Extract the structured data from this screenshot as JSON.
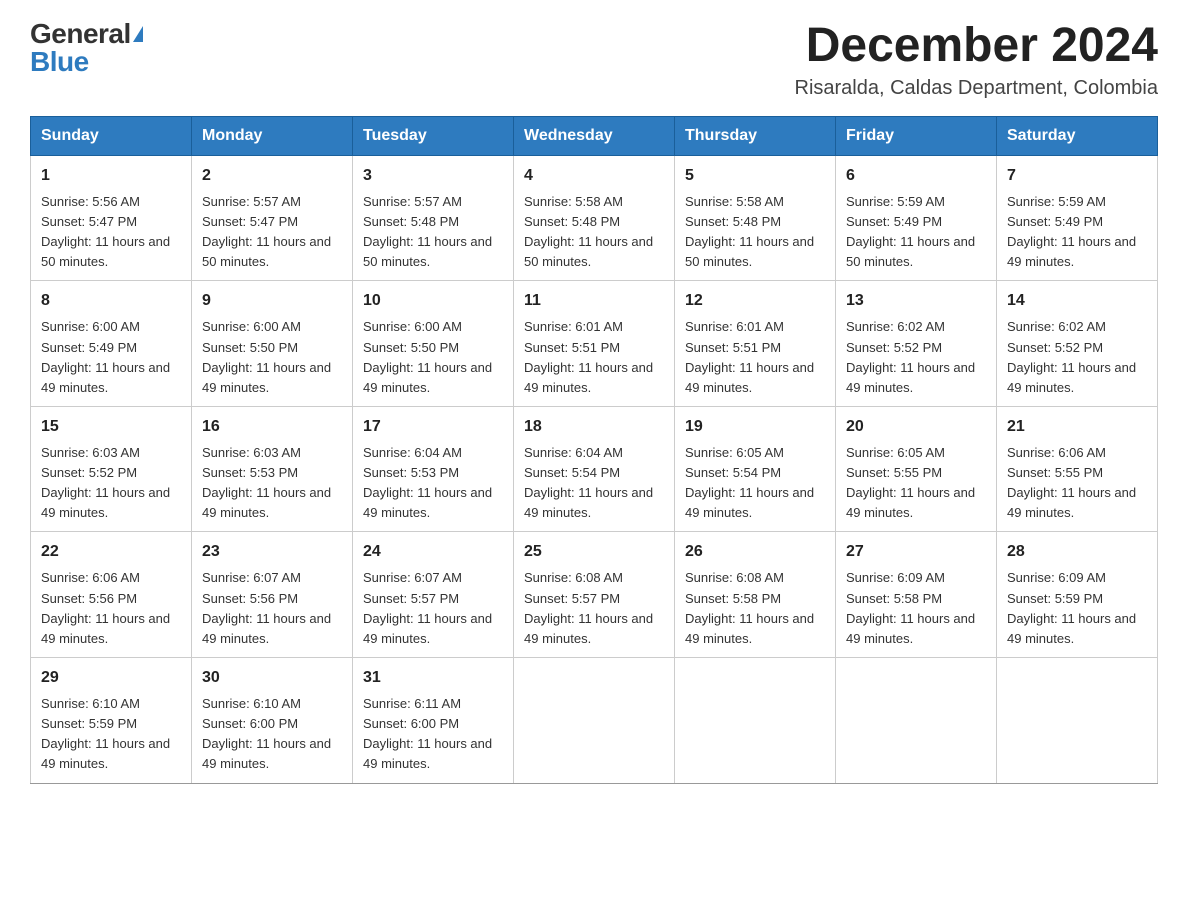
{
  "logo": {
    "general": "General",
    "blue": "Blue"
  },
  "title": {
    "month_year": "December 2024",
    "location": "Risaralda, Caldas Department, Colombia"
  },
  "headers": [
    "Sunday",
    "Monday",
    "Tuesday",
    "Wednesday",
    "Thursday",
    "Friday",
    "Saturday"
  ],
  "weeks": [
    [
      {
        "day": "1",
        "sunrise": "Sunrise: 5:56 AM",
        "sunset": "Sunset: 5:47 PM",
        "daylight": "Daylight: 11 hours and 50 minutes."
      },
      {
        "day": "2",
        "sunrise": "Sunrise: 5:57 AM",
        "sunset": "Sunset: 5:47 PM",
        "daylight": "Daylight: 11 hours and 50 minutes."
      },
      {
        "day": "3",
        "sunrise": "Sunrise: 5:57 AM",
        "sunset": "Sunset: 5:48 PM",
        "daylight": "Daylight: 11 hours and 50 minutes."
      },
      {
        "day": "4",
        "sunrise": "Sunrise: 5:58 AM",
        "sunset": "Sunset: 5:48 PM",
        "daylight": "Daylight: 11 hours and 50 minutes."
      },
      {
        "day": "5",
        "sunrise": "Sunrise: 5:58 AM",
        "sunset": "Sunset: 5:48 PM",
        "daylight": "Daylight: 11 hours and 50 minutes."
      },
      {
        "day": "6",
        "sunrise": "Sunrise: 5:59 AM",
        "sunset": "Sunset: 5:49 PM",
        "daylight": "Daylight: 11 hours and 50 minutes."
      },
      {
        "day": "7",
        "sunrise": "Sunrise: 5:59 AM",
        "sunset": "Sunset: 5:49 PM",
        "daylight": "Daylight: 11 hours and 49 minutes."
      }
    ],
    [
      {
        "day": "8",
        "sunrise": "Sunrise: 6:00 AM",
        "sunset": "Sunset: 5:49 PM",
        "daylight": "Daylight: 11 hours and 49 minutes."
      },
      {
        "day": "9",
        "sunrise": "Sunrise: 6:00 AM",
        "sunset": "Sunset: 5:50 PM",
        "daylight": "Daylight: 11 hours and 49 minutes."
      },
      {
        "day": "10",
        "sunrise": "Sunrise: 6:00 AM",
        "sunset": "Sunset: 5:50 PM",
        "daylight": "Daylight: 11 hours and 49 minutes."
      },
      {
        "day": "11",
        "sunrise": "Sunrise: 6:01 AM",
        "sunset": "Sunset: 5:51 PM",
        "daylight": "Daylight: 11 hours and 49 minutes."
      },
      {
        "day": "12",
        "sunrise": "Sunrise: 6:01 AM",
        "sunset": "Sunset: 5:51 PM",
        "daylight": "Daylight: 11 hours and 49 minutes."
      },
      {
        "day": "13",
        "sunrise": "Sunrise: 6:02 AM",
        "sunset": "Sunset: 5:52 PM",
        "daylight": "Daylight: 11 hours and 49 minutes."
      },
      {
        "day": "14",
        "sunrise": "Sunrise: 6:02 AM",
        "sunset": "Sunset: 5:52 PM",
        "daylight": "Daylight: 11 hours and 49 minutes."
      }
    ],
    [
      {
        "day": "15",
        "sunrise": "Sunrise: 6:03 AM",
        "sunset": "Sunset: 5:52 PM",
        "daylight": "Daylight: 11 hours and 49 minutes."
      },
      {
        "day": "16",
        "sunrise": "Sunrise: 6:03 AM",
        "sunset": "Sunset: 5:53 PM",
        "daylight": "Daylight: 11 hours and 49 minutes."
      },
      {
        "day": "17",
        "sunrise": "Sunrise: 6:04 AM",
        "sunset": "Sunset: 5:53 PM",
        "daylight": "Daylight: 11 hours and 49 minutes."
      },
      {
        "day": "18",
        "sunrise": "Sunrise: 6:04 AM",
        "sunset": "Sunset: 5:54 PM",
        "daylight": "Daylight: 11 hours and 49 minutes."
      },
      {
        "day": "19",
        "sunrise": "Sunrise: 6:05 AM",
        "sunset": "Sunset: 5:54 PM",
        "daylight": "Daylight: 11 hours and 49 minutes."
      },
      {
        "day": "20",
        "sunrise": "Sunrise: 6:05 AM",
        "sunset": "Sunset: 5:55 PM",
        "daylight": "Daylight: 11 hours and 49 minutes."
      },
      {
        "day": "21",
        "sunrise": "Sunrise: 6:06 AM",
        "sunset": "Sunset: 5:55 PM",
        "daylight": "Daylight: 11 hours and 49 minutes."
      }
    ],
    [
      {
        "day": "22",
        "sunrise": "Sunrise: 6:06 AM",
        "sunset": "Sunset: 5:56 PM",
        "daylight": "Daylight: 11 hours and 49 minutes."
      },
      {
        "day": "23",
        "sunrise": "Sunrise: 6:07 AM",
        "sunset": "Sunset: 5:56 PM",
        "daylight": "Daylight: 11 hours and 49 minutes."
      },
      {
        "day": "24",
        "sunrise": "Sunrise: 6:07 AM",
        "sunset": "Sunset: 5:57 PM",
        "daylight": "Daylight: 11 hours and 49 minutes."
      },
      {
        "day": "25",
        "sunrise": "Sunrise: 6:08 AM",
        "sunset": "Sunset: 5:57 PM",
        "daylight": "Daylight: 11 hours and 49 minutes."
      },
      {
        "day": "26",
        "sunrise": "Sunrise: 6:08 AM",
        "sunset": "Sunset: 5:58 PM",
        "daylight": "Daylight: 11 hours and 49 minutes."
      },
      {
        "day": "27",
        "sunrise": "Sunrise: 6:09 AM",
        "sunset": "Sunset: 5:58 PM",
        "daylight": "Daylight: 11 hours and 49 minutes."
      },
      {
        "day": "28",
        "sunrise": "Sunrise: 6:09 AM",
        "sunset": "Sunset: 5:59 PM",
        "daylight": "Daylight: 11 hours and 49 minutes."
      }
    ],
    [
      {
        "day": "29",
        "sunrise": "Sunrise: 6:10 AM",
        "sunset": "Sunset: 5:59 PM",
        "daylight": "Daylight: 11 hours and 49 minutes."
      },
      {
        "day": "30",
        "sunrise": "Sunrise: 6:10 AM",
        "sunset": "Sunset: 6:00 PM",
        "daylight": "Daylight: 11 hours and 49 minutes."
      },
      {
        "day": "31",
        "sunrise": "Sunrise: 6:11 AM",
        "sunset": "Sunset: 6:00 PM",
        "daylight": "Daylight: 11 hours and 49 minutes."
      },
      null,
      null,
      null,
      null
    ]
  ]
}
